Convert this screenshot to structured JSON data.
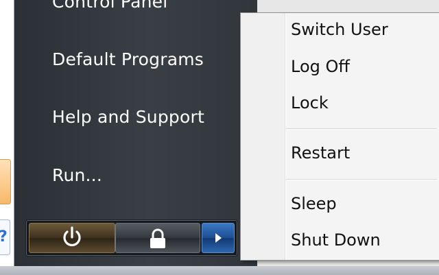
{
  "start_menu": {
    "items": [
      {
        "label": "Control Panel"
      },
      {
        "label": "Default Programs"
      },
      {
        "label": "Help and Support"
      },
      {
        "label": "Run..."
      }
    ],
    "buttons": {
      "power_icon": "power-icon",
      "lock_icon": "lock-icon",
      "arrow_icon": "arrow-right-icon"
    }
  },
  "shutdown_menu": {
    "items": [
      {
        "label": "Switch User"
      },
      {
        "label": "Log Off"
      },
      {
        "label": "Lock"
      },
      {
        "label": "Restart"
      },
      {
        "label": "Sleep"
      },
      {
        "label": "Shut Down"
      }
    ]
  },
  "colors": {
    "menu_bg": "#f4f4f4",
    "dark_pane": "#353a40",
    "arrow_accent": "#1c4e92"
  }
}
